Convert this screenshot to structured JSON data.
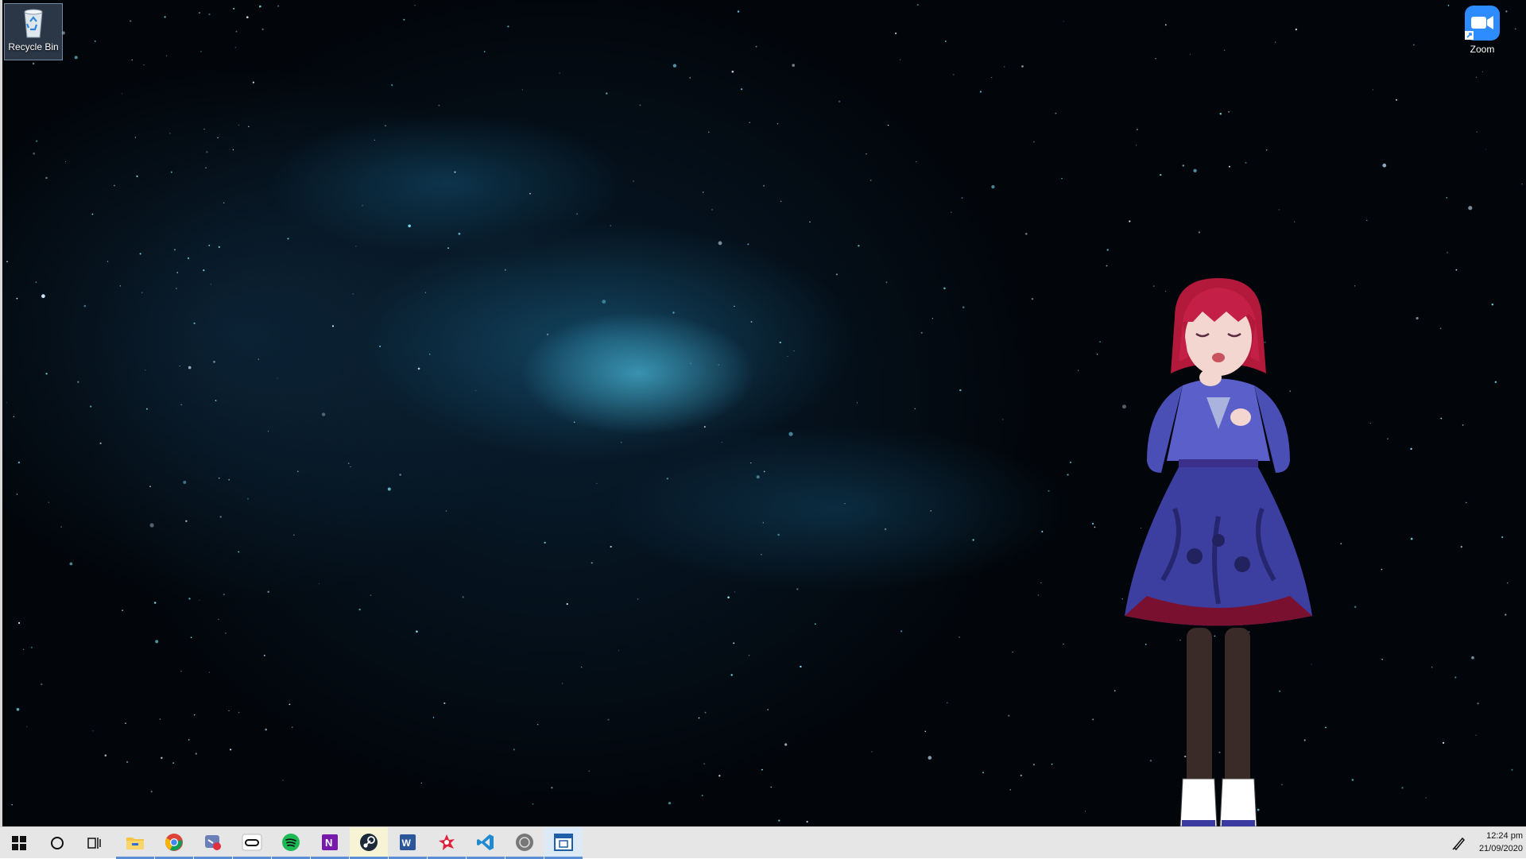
{
  "desktop": {
    "icons": [
      {
        "label": "Recycle Bin",
        "icon": "recycle-bin-icon"
      },
      {
        "label": "Zoom",
        "icon": "zoom-icon"
      }
    ]
  },
  "taskbar": {
    "items": [
      {
        "name": "start",
        "icon": "windows-logo-icon"
      },
      {
        "name": "search",
        "icon": "cortana-circle-icon"
      },
      {
        "name": "task-view",
        "icon": "task-view-icon"
      },
      {
        "name": "file-explorer",
        "icon": "folder-icon"
      },
      {
        "name": "chrome",
        "icon": "chrome-icon"
      },
      {
        "name": "snip-sketch",
        "icon": "snip-icon"
      },
      {
        "name": "oculus",
        "icon": "oculus-icon"
      },
      {
        "name": "spotify",
        "icon": "spotify-icon"
      },
      {
        "name": "onenote",
        "icon": "onenote-icon"
      },
      {
        "name": "steam",
        "icon": "steam-icon"
      },
      {
        "name": "word",
        "icon": "word-icon"
      },
      {
        "name": "vroid",
        "icon": "vroid-icon"
      },
      {
        "name": "vscode",
        "icon": "vscode-icon"
      },
      {
        "name": "app-gray",
        "icon": "gray-app-icon"
      },
      {
        "name": "app-window",
        "icon": "window-app-icon"
      }
    ],
    "clock": {
      "time": "12:24 pm",
      "date": "21/09/2020"
    }
  },
  "colors": {
    "taskbar_bg": "#e6e6e6",
    "accent": "#5a8fd8",
    "zoom_blue": "#2d8cff"
  }
}
